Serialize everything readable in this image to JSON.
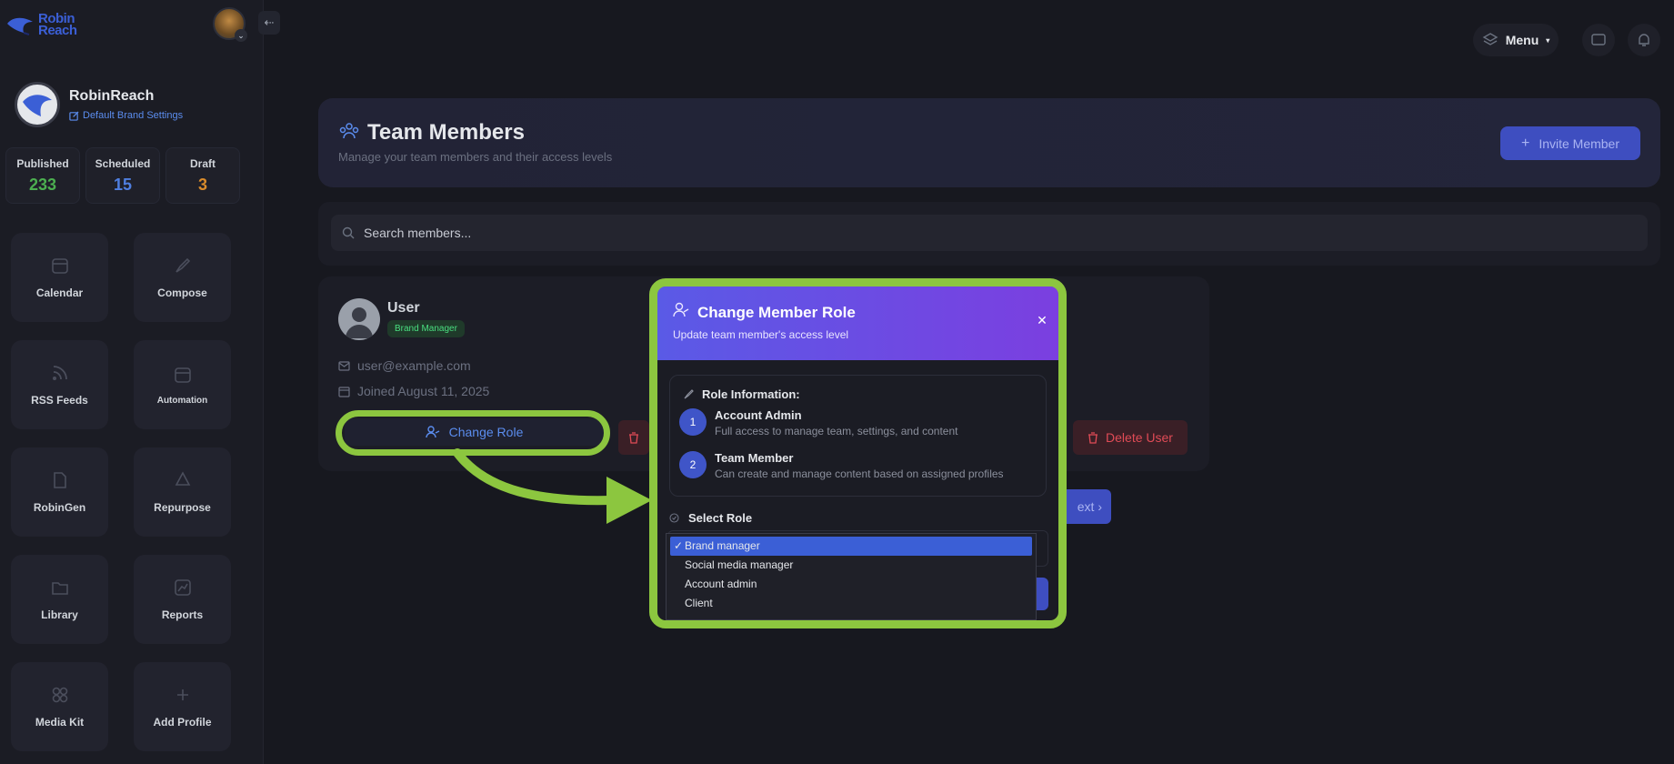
{
  "brand": {
    "logo_line1": "Robin",
    "logo_line2": "Reach"
  },
  "sidebar": {
    "profile_name": "RobinReach",
    "profile_link": "Default Brand Settings",
    "stats": [
      {
        "label": "Published",
        "value": "233",
        "color": "#4caf50"
      },
      {
        "label": "Scheduled",
        "value": "15",
        "color": "#4f7fe0"
      },
      {
        "label": "Draft",
        "value": "3",
        "color": "#d98b2b"
      }
    ],
    "nav": [
      {
        "label": "Calendar",
        "icon": "calendar-icon"
      },
      {
        "label": "Compose",
        "icon": "rocket-icon"
      },
      {
        "label": "RSS Feeds",
        "icon": "rss-icon"
      },
      {
        "label": "Automation",
        "icon": "automation-icon"
      },
      {
        "label": "RobinGen",
        "icon": "robingen-icon"
      },
      {
        "label": "Repurpose",
        "icon": "recycle-icon"
      },
      {
        "label": "Library",
        "icon": "folder-icon"
      },
      {
        "label": "Reports",
        "icon": "chart-icon"
      },
      {
        "label": "Media Kit",
        "icon": "grid-icon"
      },
      {
        "label": "Add Profile",
        "icon": "plus-icon"
      }
    ]
  },
  "topbar": {
    "menu_label": "Menu"
  },
  "header": {
    "title": "Team Members",
    "subtitle": "Manage your team members and their access levels",
    "invite_label": "Invite Member"
  },
  "search": {
    "placeholder": "Search members..."
  },
  "member": {
    "name": "User",
    "role_badge": "Brand Manager",
    "email": "user@example.com",
    "joined": "Joined August 11, 2025",
    "change_role_label": "Change Role",
    "delete_label": "Delete User"
  },
  "pagination": {
    "next_label": "ext ›"
  },
  "modal": {
    "title": "Change Member Role",
    "subtitle": "Update team member's access level",
    "role_info_title": "Role Information:",
    "roles": [
      {
        "num": "1",
        "name": "Account Admin",
        "desc": "Full access to manage team, settings, and content"
      },
      {
        "num": "2",
        "name": "Team Member",
        "desc": "Can create and manage content based on assigned profiles"
      }
    ],
    "select_label": "Select Role",
    "options": [
      "Brand manager",
      "Social media manager",
      "Account admin",
      "Client"
    ],
    "selected_option": "Brand manager"
  },
  "colors": {
    "accent": "#3e4ec0",
    "highlight": "#8cc63f",
    "danger": "#e04b56"
  }
}
